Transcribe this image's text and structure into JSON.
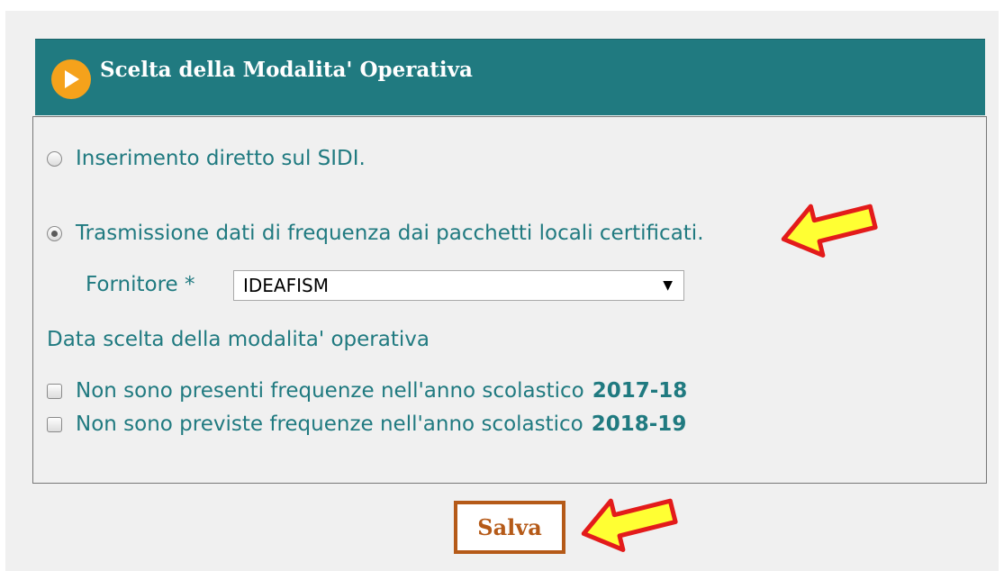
{
  "header": {
    "title": "Scelta della Modalita' Operativa",
    "icon": "play-icon",
    "background_color": "#207a80",
    "icon_color": "#f5a21b"
  },
  "options": {
    "direct": {
      "label": "Inserimento diretto sul SIDI.",
      "selected": false
    },
    "transmission": {
      "label": "Trasmissione dati di frequenza dai pacchetti locali certificati.",
      "selected": true
    }
  },
  "fornitore": {
    "label": "Fornitore *",
    "value": "IDEAFISM"
  },
  "data_scelta": {
    "label": "Data scelta della modalita' operativa"
  },
  "checks": [
    {
      "label": "Non sono presenti frequenze nell'anno scolastico",
      "year": "2017-18",
      "checked": false
    },
    {
      "label": "Non sono previste frequenze nell'anno scolastico",
      "year": "2018-19",
      "checked": false
    }
  ],
  "save_button": {
    "label": "Salva",
    "color": "#b55a18"
  },
  "annotation_arrow_color": "#ffff33"
}
